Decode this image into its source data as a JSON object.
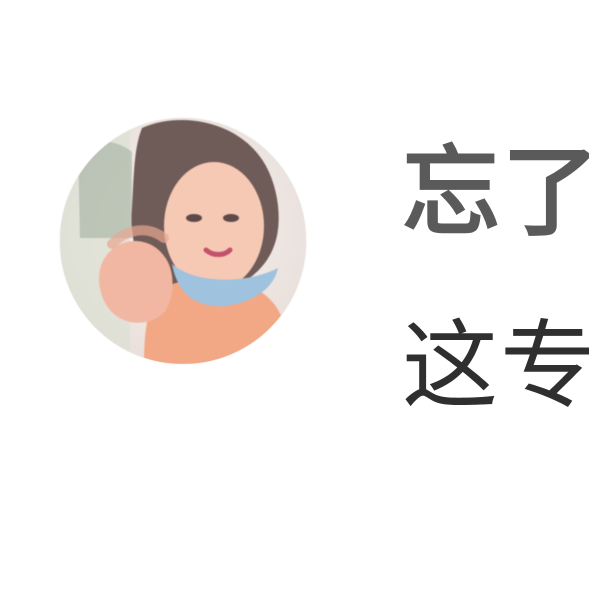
{
  "avatar": {
    "icon": "user-avatar-photo",
    "colors": {
      "background": "#f3ece7",
      "skin": "#f6c9b5",
      "hair": "#6f5b57",
      "shirt": "#f2a884",
      "mask": "#9fc2df"
    }
  },
  "post": {
    "title_fragment": "忘了",
    "subtitle_fragment": "这专"
  },
  "colors": {
    "title_text": "#5a5a5a",
    "subtitle_text": "#2f2f2f",
    "page_background": "#ffffff"
  }
}
